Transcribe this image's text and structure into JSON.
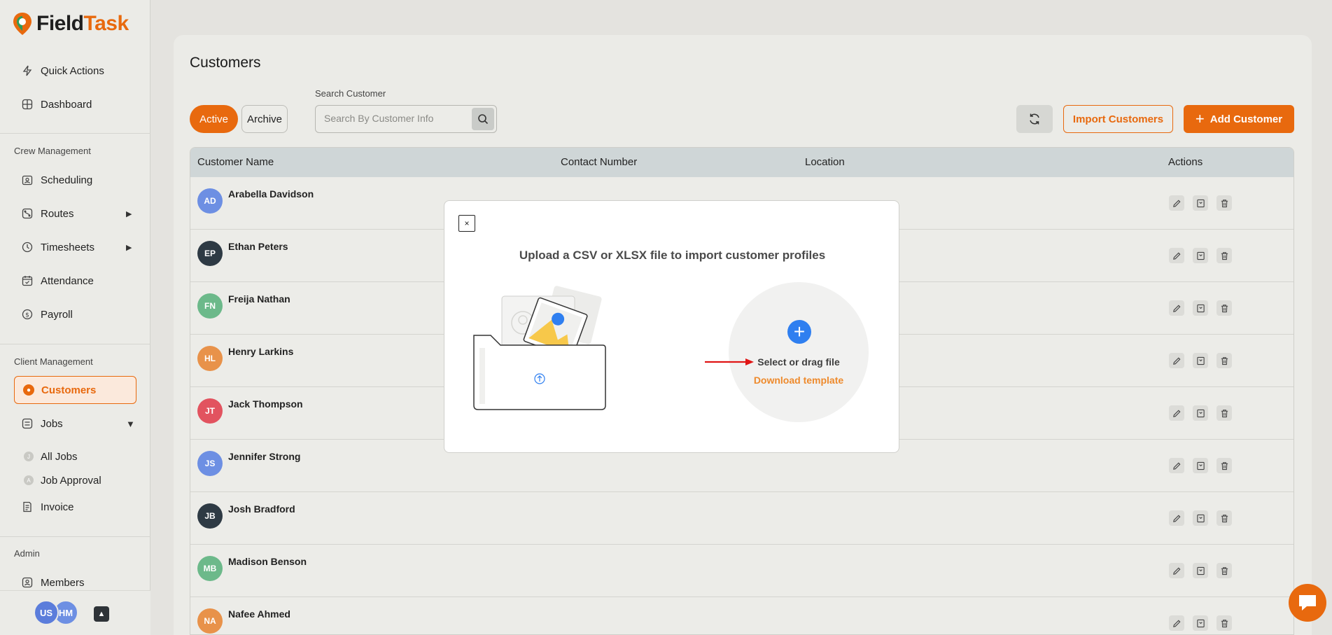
{
  "app": {
    "logo_prefix": "Field",
    "logo_suffix": "Task"
  },
  "sidebar": {
    "top_items": [
      {
        "label": "Quick Actions",
        "icon": "bolt-icon"
      },
      {
        "label": "Dashboard",
        "icon": "grid-icon"
      }
    ],
    "crew_section": "Crew Management",
    "crew_items": [
      {
        "label": "Scheduling",
        "icon": "calendar-person-icon"
      },
      {
        "label": "Routes",
        "icon": "route-icon"
      },
      {
        "label": "Timesheets",
        "icon": "clock-icon"
      },
      {
        "label": "Attendance",
        "icon": "calendar-check-icon"
      },
      {
        "label": "Payroll",
        "icon": "dollar-icon"
      }
    ],
    "client_section": "Client Management",
    "customers_label": "Customers",
    "jobs_label": "Jobs",
    "job_sub_items": [
      {
        "label": "All Jobs",
        "initial": "J"
      },
      {
        "label": "Job Approval",
        "initial": "A"
      }
    ],
    "invoice_label": "Invoice",
    "admin_section": "Admin",
    "members_label": "Members",
    "footer": {
      "user_initials": "US",
      "org_initials": "HM"
    }
  },
  "page": {
    "title": "Customers",
    "tabs": [
      "Active",
      "Archive"
    ],
    "search_label": "Search Customer",
    "search_placeholder": "Search By Customer Info",
    "import_label": "Import Customers",
    "add_label": "Add Customer"
  },
  "table": {
    "columns": [
      "Customer Name",
      "Contact Number",
      "Location",
      "Actions"
    ],
    "rows": [
      {
        "initials": "AD",
        "name": "Arabella Davidson",
        "color": "#6d8fe3"
      },
      {
        "initials": "EP",
        "name": "Ethan Peters",
        "color": "#2e3a44"
      },
      {
        "initials": "FN",
        "name": "Freija Nathan",
        "color": "#6cb98a"
      },
      {
        "initials": "HL",
        "name": "Henry Larkins",
        "color": "#e8924a"
      },
      {
        "initials": "JT",
        "name": "Jack Thompson",
        "color": "#e2535f"
      },
      {
        "initials": "JS",
        "name": "Jennifer Strong",
        "color": "#6d8fe3"
      },
      {
        "initials": "JB",
        "name": "Josh Bradford",
        "color": "#2e3a44"
      },
      {
        "initials": "MB",
        "name": "Madison Benson",
        "color": "#6cb98a"
      },
      {
        "initials": "NA",
        "name": "Nafee Ahmed",
        "color": "#e8924a"
      }
    ]
  },
  "modal": {
    "close_label": "×",
    "title": "Upload a CSV or XLSX file to import customer profiles",
    "select_label": "Select or drag file",
    "download_label": "Download template"
  },
  "colors": {
    "accent": "#e8690e",
    "link": "#ee8a2c",
    "upload_plus": "#2f7ff0"
  }
}
